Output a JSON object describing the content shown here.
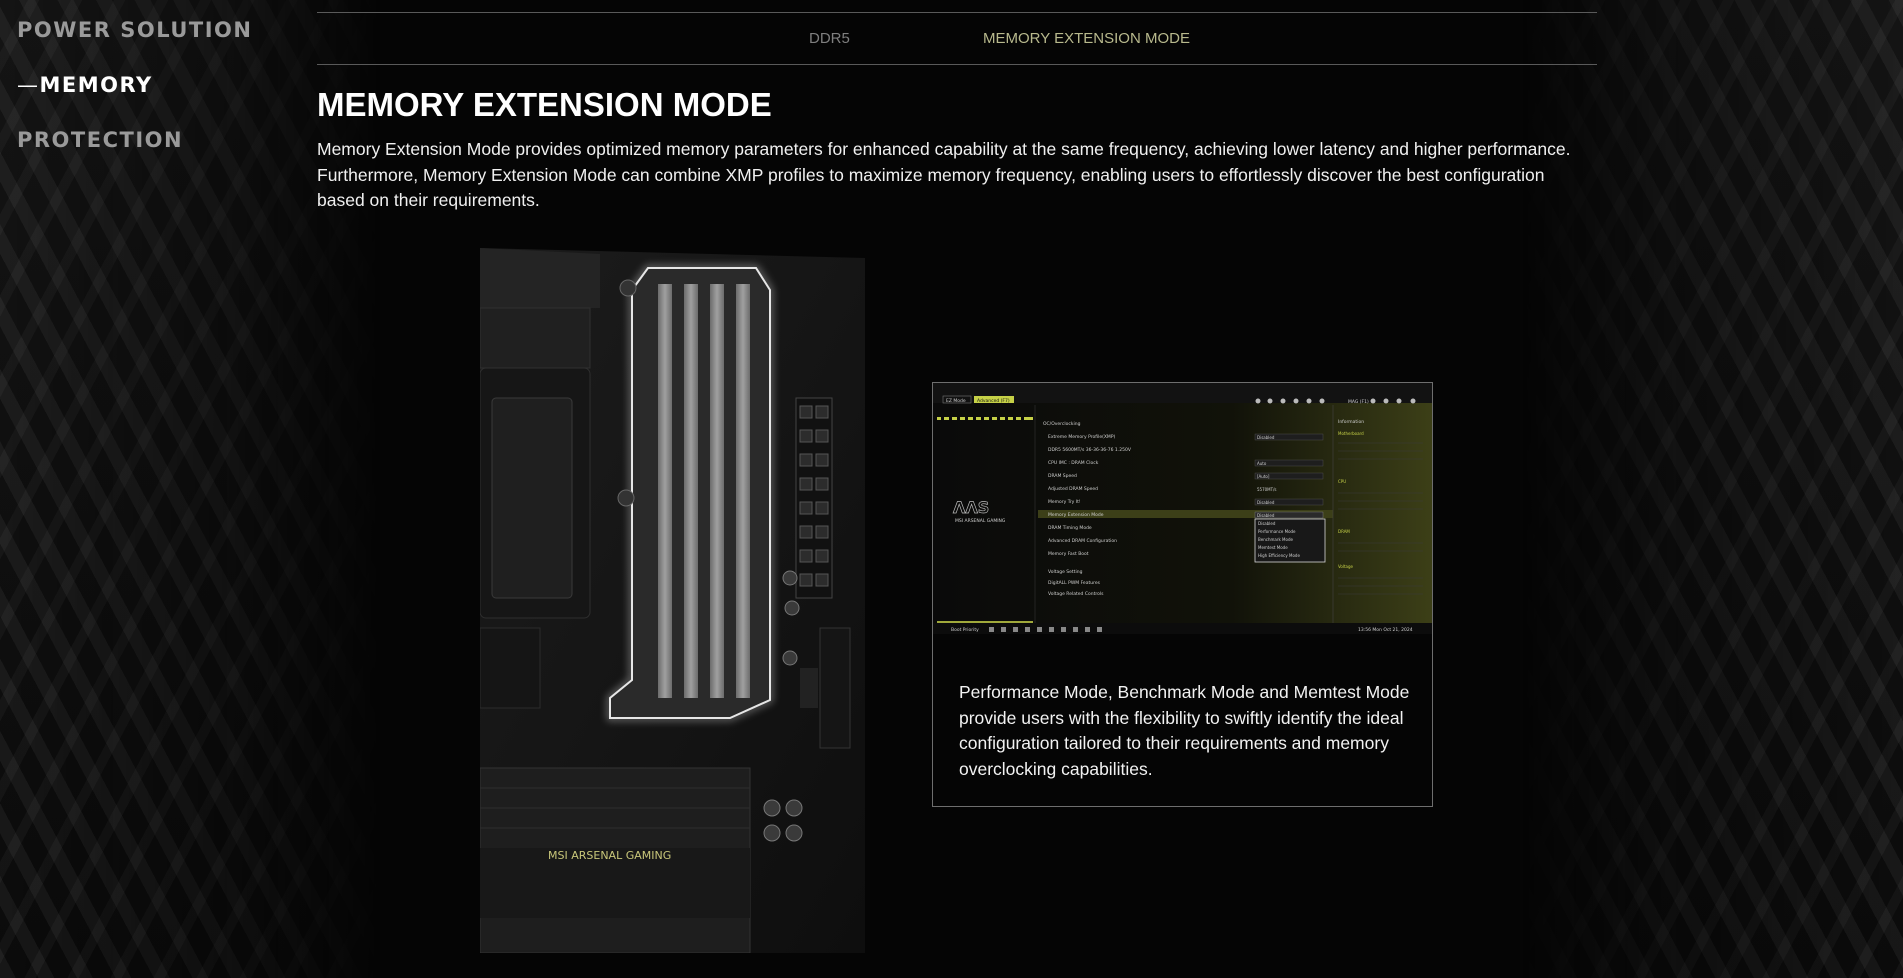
{
  "sidebar": {
    "items": [
      {
        "label": "POWER SOLUTION"
      },
      {
        "dash": "—",
        "label": "MEMORY"
      },
      {
        "label": "PROTECTION"
      }
    ]
  },
  "tabs": [
    {
      "label": "DDR5"
    },
    {
      "label": "MEMORY EXTENSION MODE"
    }
  ],
  "section": {
    "title": "MEMORY EXTENSION MODE",
    "description": "Memory Extension Mode provides optimized memory parameters for enhanced capability at the same frequency, achieving lower latency and higher performance. Furthermore, Memory Extension Mode can combine XMP profiles to maximize memory frequency, enabling users to effortlessly discover the best configuration based on their requirements."
  },
  "board": {
    "brand_label": "MSI ARSENAL GAMING"
  },
  "bios": {
    "mode_tabs": [
      "EZ Mode",
      "Advanced (F7)"
    ],
    "header_right": "MAG (F1)",
    "breadcrumb": "OC/Overclocking",
    "logo_text": "MSI ARSENAL GAMING",
    "settings": [
      {
        "label": "Extreme Memory Profile(XMP)",
        "value": "Disabled"
      },
      {
        "label": "DDR5 5600MT/s 36-36-36-76 1.250V",
        "value": ""
      },
      {
        "label": "CPU IMC : DRAM Clock",
        "value": "Auto"
      },
      {
        "label": "DRAM Speed",
        "value": "[Auto]"
      },
      {
        "label": "Adjusted DRAM Speed",
        "value": "5570MT/s"
      },
      {
        "label": "Memory Try It!",
        "value": "Disabled"
      },
      {
        "label": "Memory Extension Mode",
        "value": "Disabled"
      },
      {
        "label": "DRAM Timing Mode",
        "value": ""
      },
      {
        "label": "Advanced DRAM Configuration",
        "value": ""
      },
      {
        "label": "Memory Fast Boot",
        "value": ""
      },
      {
        "label": "Voltage Setting",
        "value": ""
      },
      {
        "label": "DigitALL PWM Features",
        "value": ""
      },
      {
        "label": "Voltage Related Controls",
        "value": ""
      }
    ],
    "dropdown_options": [
      "Disabled",
      "Performance Mode",
      "Benchmark Mode",
      "Memtest Mode",
      "High Efficiency Mode"
    ],
    "info": {
      "heading": "Information",
      "groups": [
        "Motherboard",
        "CPU",
        "DRAM",
        "Voltage"
      ]
    },
    "footer_left": "Boot Priority",
    "footer_right": "13:56  Mon Oct 21, 2024"
  },
  "card": {
    "caption": "Performance Mode, Benchmark Mode and Memtest Mode provide users with the flexibility to swiftly identify the ideal configuration tailored to their requirements and memory overclocking capabilities."
  },
  "colors": {
    "accent": "#b8b98d",
    "bios_accent": "#c6d147",
    "tab_inactive": "#7f7f7f",
    "nav_inactive": "#9a9a9a"
  }
}
